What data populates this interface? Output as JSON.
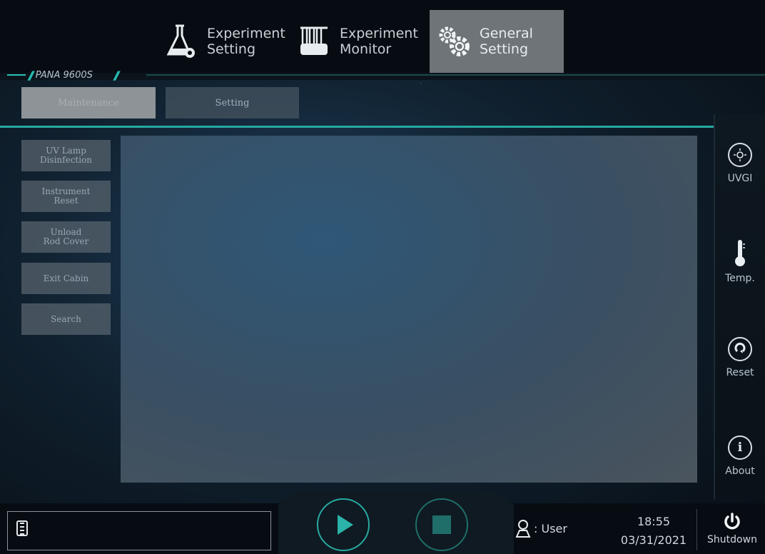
{
  "header": {
    "tabs": [
      {
        "line1": "Experiment",
        "line2": "Setting",
        "icon": "flask-gear-icon"
      },
      {
        "line1": "Experiment",
        "line2": "Monitor",
        "icon": "test-tubes-icon"
      },
      {
        "line1": "General",
        "line2": "Setting",
        "icon": "gears-icon",
        "active": true
      }
    ],
    "brand": "PANA 9600S"
  },
  "subtabs": [
    {
      "label": "Maintenance",
      "active": true
    },
    {
      "label": "Setting"
    }
  ],
  "side_menu": [
    {
      "line1": "UV Lamp",
      "line2": "Disinfection"
    },
    {
      "line1": "Instrument",
      "line2": "Reset"
    },
    {
      "line1": "Unload",
      "line2": "Rod Cover"
    },
    {
      "line1": "Exit Cabin",
      "line2": ""
    },
    {
      "line1": "Search",
      "line2": ""
    }
  ],
  "right_rail": [
    {
      "label": "UVGI",
      "icon": "sun-icon"
    },
    {
      "label": "Temp.",
      "icon": "thermometer-icon"
    },
    {
      "label": "Reset",
      "icon": "reset-icon"
    },
    {
      "label": "About",
      "icon": "info-icon"
    }
  ],
  "footer": {
    "user_label": ": User",
    "time": "18:55",
    "date": "03/31/2021",
    "shutdown_label": "Shutdown"
  },
  "colors": {
    "accent": "#27a9a0",
    "active_tab": "#6e7478",
    "panel": "#3a4f62"
  }
}
